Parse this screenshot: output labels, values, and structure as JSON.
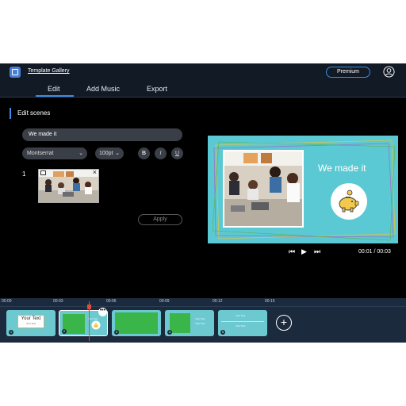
{
  "header": {
    "gallery_link": "Template Gallery",
    "premium_label": "Premium"
  },
  "tabs": [
    {
      "label": "Edit",
      "active": true
    },
    {
      "label": "Add Music",
      "active": false
    },
    {
      "label": "Export",
      "active": false
    }
  ],
  "editor": {
    "section_title": "Edit scenes",
    "text_value": "We made it",
    "font_family": "Montserrat",
    "font_size": "100pt",
    "format_buttons": [
      "B",
      "I",
      "U"
    ],
    "scene_number": "1",
    "apply_label": "Apply"
  },
  "preview": {
    "headline": "We made it",
    "time_current": "00:01",
    "time_total": "00:03",
    "time_display": "00:01 / 00:03",
    "background_color": "#5bc9d3"
  },
  "timeline": {
    "ticks": [
      "00:00",
      "00:03",
      "00:06",
      "00:09",
      "00:12",
      "00:15"
    ],
    "clips": [
      {
        "num": "1",
        "title": "Your Text",
        "subtitle": "Your Text"
      },
      {
        "num": "2",
        "title": "Your Text",
        "subtitle": ""
      },
      {
        "num": "3",
        "title": "",
        "subtitle": ""
      },
      {
        "num": "4",
        "title": "Your Text",
        "subtitle": "Your Text"
      },
      {
        "num": "5",
        "title": "Your Text",
        "subtitle": "Your Text"
      }
    ],
    "more_label": "•••",
    "add_label": "+"
  },
  "icons": [
    "app-logo-icon",
    "user-avatar-icon",
    "close-icon",
    "crop-icon",
    "skip-back-icon",
    "play-icon",
    "skip-forward-icon",
    "piggy-bank-icon",
    "chevron-down-icon",
    "add-icon",
    "more-icon"
  ]
}
